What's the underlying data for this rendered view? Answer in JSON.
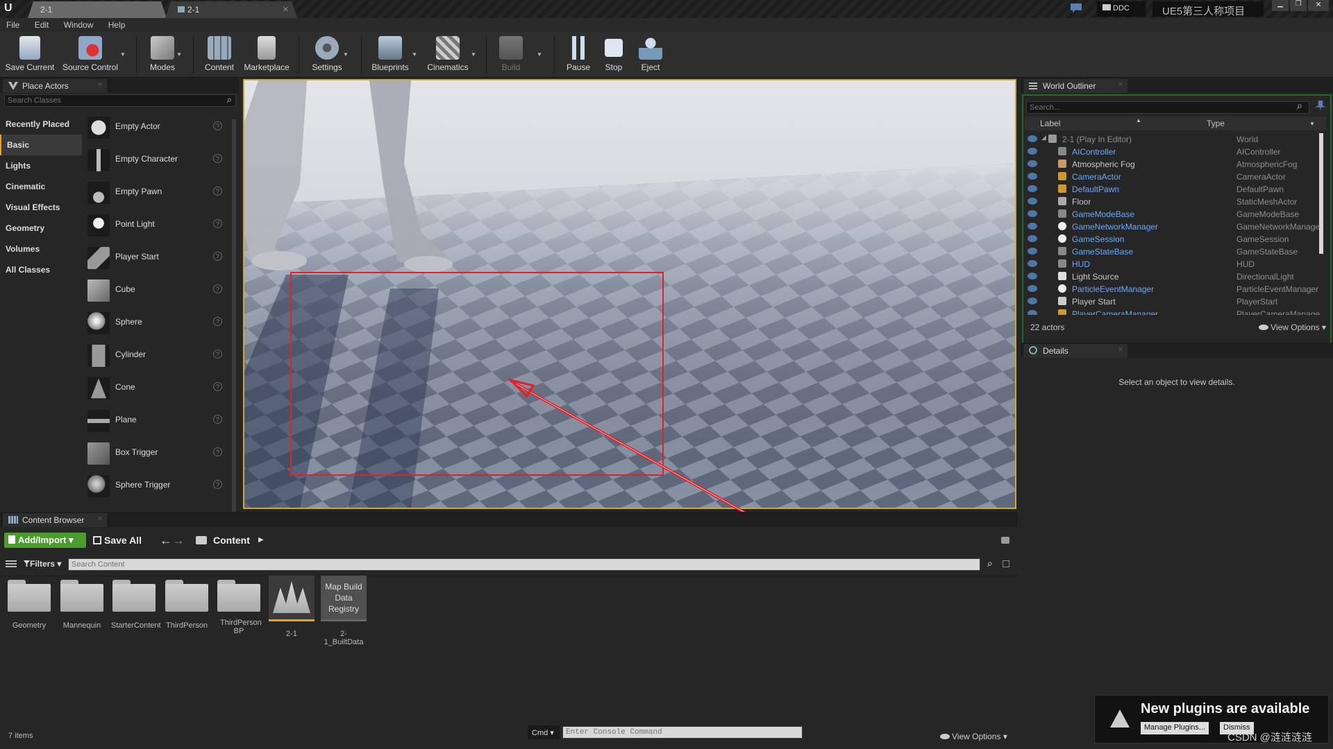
{
  "window": {
    "tabs": [
      "2-1",
      "2-1"
    ],
    "ddc_label": "DDC",
    "project_name": "UE5第三人称项目"
  },
  "menu": [
    "File",
    "Edit",
    "Window",
    "Help"
  ],
  "toolbar": {
    "save_current": "Save Current",
    "source_control": "Source Control",
    "modes": "Modes",
    "content": "Content",
    "marketplace": "Marketplace",
    "settings": "Settings",
    "blueprints": "Blueprints",
    "cinematics": "Cinematics",
    "build": "Build",
    "pause": "Pause",
    "stop": "Stop",
    "eject": "Eject"
  },
  "place_actors": {
    "title": "Place Actors",
    "search_placeholder": "Search Classes",
    "categories": [
      "Recently Placed",
      "Basic",
      "Lights",
      "Cinematic",
      "Visual Effects",
      "Geometry",
      "Volumes",
      "All Classes"
    ],
    "selected_category": "Basic",
    "actors": [
      "Empty Actor",
      "Empty Character",
      "Empty Pawn",
      "Point Light",
      "Player Start",
      "Cube",
      "Sphere",
      "Cylinder",
      "Cone",
      "Plane",
      "Box Trigger",
      "Sphere Trigger"
    ]
  },
  "world_outliner": {
    "title": "World Outliner",
    "search_placeholder": "Search...",
    "col_label": "Label",
    "col_type": "Type",
    "rows": [
      {
        "label": "2-1 (Play In Editor)",
        "type": "World"
      },
      {
        "label": "AIController",
        "type": "AIController"
      },
      {
        "label": "Atmospheric Fog",
        "type": "AtmosphericFog"
      },
      {
        "label": "CameraActor",
        "type": "CameraActor"
      },
      {
        "label": "DefaultPawn",
        "type": "DefaultPawn"
      },
      {
        "label": "Floor",
        "type": "StaticMeshActor"
      },
      {
        "label": "GameModeBase",
        "type": "GameModeBase"
      },
      {
        "label": "GameNetworkManager",
        "type": "GameNetworkManager"
      },
      {
        "label": "GameSession",
        "type": "GameSession"
      },
      {
        "label": "GameStateBase",
        "type": "GameStateBase"
      },
      {
        "label": "HUD",
        "type": "HUD"
      },
      {
        "label": "Light Source",
        "type": "DirectionalLight"
      },
      {
        "label": "ParticleEventManager",
        "type": "ParticleEventManager"
      },
      {
        "label": "Player Start",
        "type": "PlayerStart"
      },
      {
        "label": "PlayerCameraManager",
        "type": "PlayerCameraManager"
      }
    ],
    "actor_count": "22 actors",
    "view_options": "View Options"
  },
  "details": {
    "title": "Details",
    "empty_message": "Select an object to view details."
  },
  "content_browser": {
    "title": "Content Browser",
    "add_import": "Add/Import",
    "save_all": "Save All",
    "path": "Content",
    "filters": "Filters",
    "search_placeholder": "Search Content",
    "assets": [
      {
        "name": "Geometry"
      },
      {
        "name": "Mannequin"
      },
      {
        "name": "StarterContent"
      },
      {
        "name": "ThirdPerson"
      },
      {
        "name": "ThirdPerson BP"
      },
      {
        "name": "2-1"
      },
      {
        "name": "2-1_BuiltData",
        "thumb_text": "Map Build Data Registry"
      }
    ],
    "item_count": "7 items",
    "view_options": "View Options"
  },
  "console": {
    "cmd_label": "Cmd",
    "placeholder": "Enter Console Command"
  },
  "notification": {
    "title": "New plugins are available",
    "manage": "Manage Plugins...",
    "dismiss": "Dismiss"
  },
  "watermark": "CSDN @涟涟涟涟",
  "colors": {
    "accent": "#e8a12a",
    "outliner_link": "#6aa9ff",
    "annotation": "#e0202a",
    "add_import_green": "#4a9c2c"
  }
}
